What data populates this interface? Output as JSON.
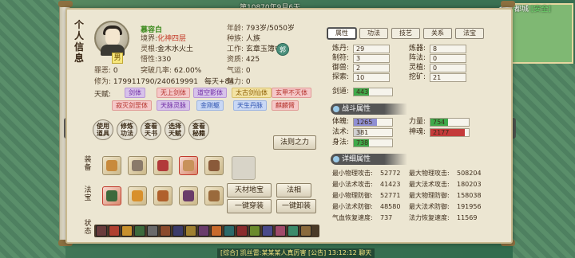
{
  "top_bar": {
    "date": "第10870年9月6天"
  },
  "minimap": {
    "city": "都城",
    "safe": "[安全]"
  },
  "close_icon": "close-icon",
  "panel": {
    "vertical_title": "个人信息",
    "character": {
      "name": "慕容白",
      "gender": "男",
      "realm_label": "境界:",
      "realm": "化神四层",
      "root_label": "灵根:",
      "root": "金木水火土",
      "insight_label": "悟性:",
      "insight": "330",
      "breakthrough_label": "突破几率:",
      "breakthrough": "62.00%",
      "sin_label": "罪恶:",
      "sin": "0",
      "cultivation_label": "修为:",
      "cultivation": "179911790/240619991",
      "daily": "每天+84",
      "age_label": "年龄:",
      "age": "793岁/5050岁",
      "race_label": "种族:",
      "race": "人族",
      "job_label": "工作:",
      "job": "玄章玉簿中",
      "aptitude_label": "资质:",
      "aptitude": "425",
      "luck_label": "气运:",
      "luck": "0",
      "charm_label": "魅力:",
      "charm": "0",
      "badge": "郭"
    },
    "talents_label": "天赋:",
    "talents": [
      {
        "label": "剑体",
        "color": "purple"
      },
      {
        "label": "无上剑体",
        "color": "pink"
      },
      {
        "label": "道空影体",
        "color": "purple"
      },
      {
        "label": "太古剑仙体",
        "color": "yellow"
      },
      {
        "label": "玄甲不灭体",
        "color": "pink"
      },
      {
        "label": "寂灭剑罡体",
        "color": "pink"
      },
      {
        "label": "天脉灵脉",
        "color": "purple"
      },
      {
        "label": "金刚躯",
        "color": "blue"
      },
      {
        "label": "天生丹脉",
        "color": "blue"
      },
      {
        "label": "麒麟臂",
        "color": "pink"
      }
    ],
    "circle_buttons": [
      {
        "l1": "使用",
        "l2": "道具"
      },
      {
        "l1": "修炼",
        "l2": "功法"
      },
      {
        "l1": "查看",
        "l2": "天书"
      },
      {
        "l1": "选择",
        "l2": "天赋"
      },
      {
        "l1": "查看",
        "l2": "秘籍"
      }
    ],
    "rule_button": "法则之力",
    "equip_label": "装备",
    "skill_label": "法宝",
    "status_label": "状态",
    "buttons": {
      "treasure": "天材地宝",
      "combine": "法相",
      "one_wear": "一键穿装",
      "one_remove": "一键卸装"
    }
  },
  "tabs": [
    "属性",
    "功法",
    "技艺",
    "关系",
    "法宝"
  ],
  "attributes": {
    "rows": [
      {
        "label": "炼丹:",
        "value": "29",
        "label2": "炼器:",
        "value2": "8"
      },
      {
        "label": "制符:",
        "value": "3",
        "label2": "阵法:",
        "value2": "0"
      },
      {
        "label": "御兽:",
        "value": "2",
        "label2": "灵植:",
        "value2": "0"
      },
      {
        "label": "探索:",
        "value": "10",
        "label2": "挖矿:",
        "value2": "21"
      }
    ],
    "sword_label": "剑道:",
    "sword": "443",
    "combat_header": "战斗属性",
    "combat": [
      {
        "label": "体魄:",
        "value": "1265",
        "color": "#8f8fd4",
        "fill": 0.6,
        "label2": "力量:",
        "value2": "754",
        "color2": "#3fa94a",
        "fill2": 0.45
      },
      {
        "label": "法术:",
        "value": "381",
        "color": "#d0d0d0",
        "fill": 0.2,
        "label2": "神魂:",
        "value2": "2177",
        "color2": "#c43a3a",
        "fill2": 0.9
      },
      {
        "label": "身法:",
        "value": "738",
        "color": "#3fa94a",
        "fill": 0.4
      }
    ],
    "detail_header": "详细属性",
    "details": [
      {
        "l": "最小物理攻击:",
        "v": "52772",
        "l2": "最大物理攻击:",
        "v2": "508204"
      },
      {
        "l": "最小法术攻击:",
        "v": "41423",
        "l2": "最大法术攻击:",
        "v2": "180203"
      },
      {
        "l": "最小物理防御:",
        "v": "52771",
        "l2": "最大物理防御:",
        "v2": "158038"
      },
      {
        "l": "最小法术防御:",
        "v": "48580",
        "l2": "最大法术防御:",
        "v2": "191956"
      },
      {
        "l": "气血恢复速度:",
        "v": "737",
        "l2": "法力恢复速度:",
        "v2": "11569"
      }
    ]
  },
  "chat": {
    "text": "[综合] 凯丝雷:某某某人真厉害 [公告] 13:12:12",
    "suffix": "聊天"
  }
}
